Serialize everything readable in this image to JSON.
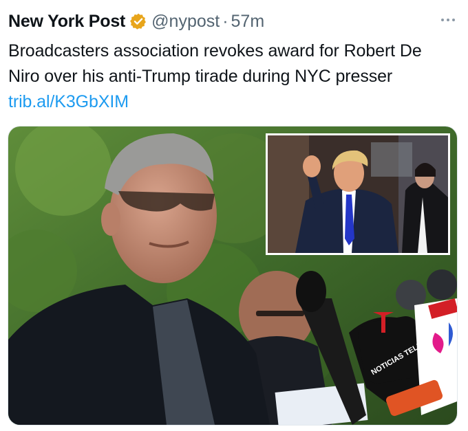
{
  "tweet": {
    "author_name": "New York Post",
    "verified_icon": "verified-badge-icon",
    "handle": "@nypost",
    "separator": "·",
    "time": "57m",
    "more_icon": "more-options-icon",
    "text": "Broadcasters association revokes award for Robert De Niro over his anti-Trump tirade during NYC presser",
    "link": "trib.al/K3GbXIM"
  },
  "media": {
    "type": "photo",
    "mic_logo_text": "NOTICIAS TELEMUNDO",
    "colors": {
      "foliage": "#3f6a2a",
      "jacket": "#14181f",
      "inset_border": "#ffffff",
      "tie": "#2436c8",
      "telemundo_red": "#d31f26"
    }
  },
  "colors": {
    "link": "#1d9bf0",
    "secondary_text": "#536471",
    "badge": "#e8a51b"
  }
}
